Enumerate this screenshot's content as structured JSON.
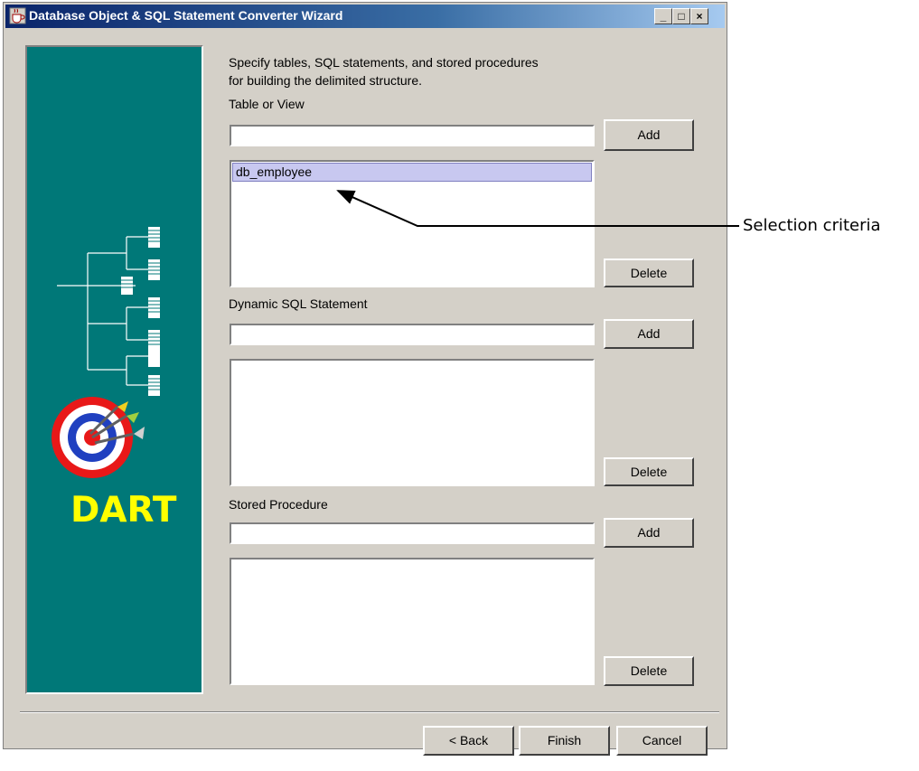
{
  "window": {
    "title": "Database Object & SQL Statement Converter Wizard",
    "minimize_glyph": "_",
    "maximize_glyph": "□",
    "close_glyph": "×"
  },
  "side_panel": {
    "logo_text": "DART",
    "colors": {
      "background": "#007878",
      "logo_text": "#ffff00"
    }
  },
  "instructions": {
    "line1": "Specify tables, SQL statements, and stored procedures",
    "line2": "for building the delimited structure."
  },
  "sections": {
    "table": {
      "label": "Table or View",
      "input_value": "",
      "add_label": "Add",
      "delete_label": "Delete",
      "items": [
        "db_employee"
      ]
    },
    "sql": {
      "label": "Dynamic SQL Statement",
      "input_value": "",
      "add_label": "Add",
      "delete_label": "Delete"
    },
    "proc": {
      "label": "Stored Procedure",
      "input_value": "",
      "add_label": "Add",
      "delete_label": "Delete"
    }
  },
  "footer": {
    "back_label": "< Back",
    "finish_label": "Finish",
    "cancel_label": "Cancel"
  },
  "callout": {
    "text": "Selection criteria"
  }
}
